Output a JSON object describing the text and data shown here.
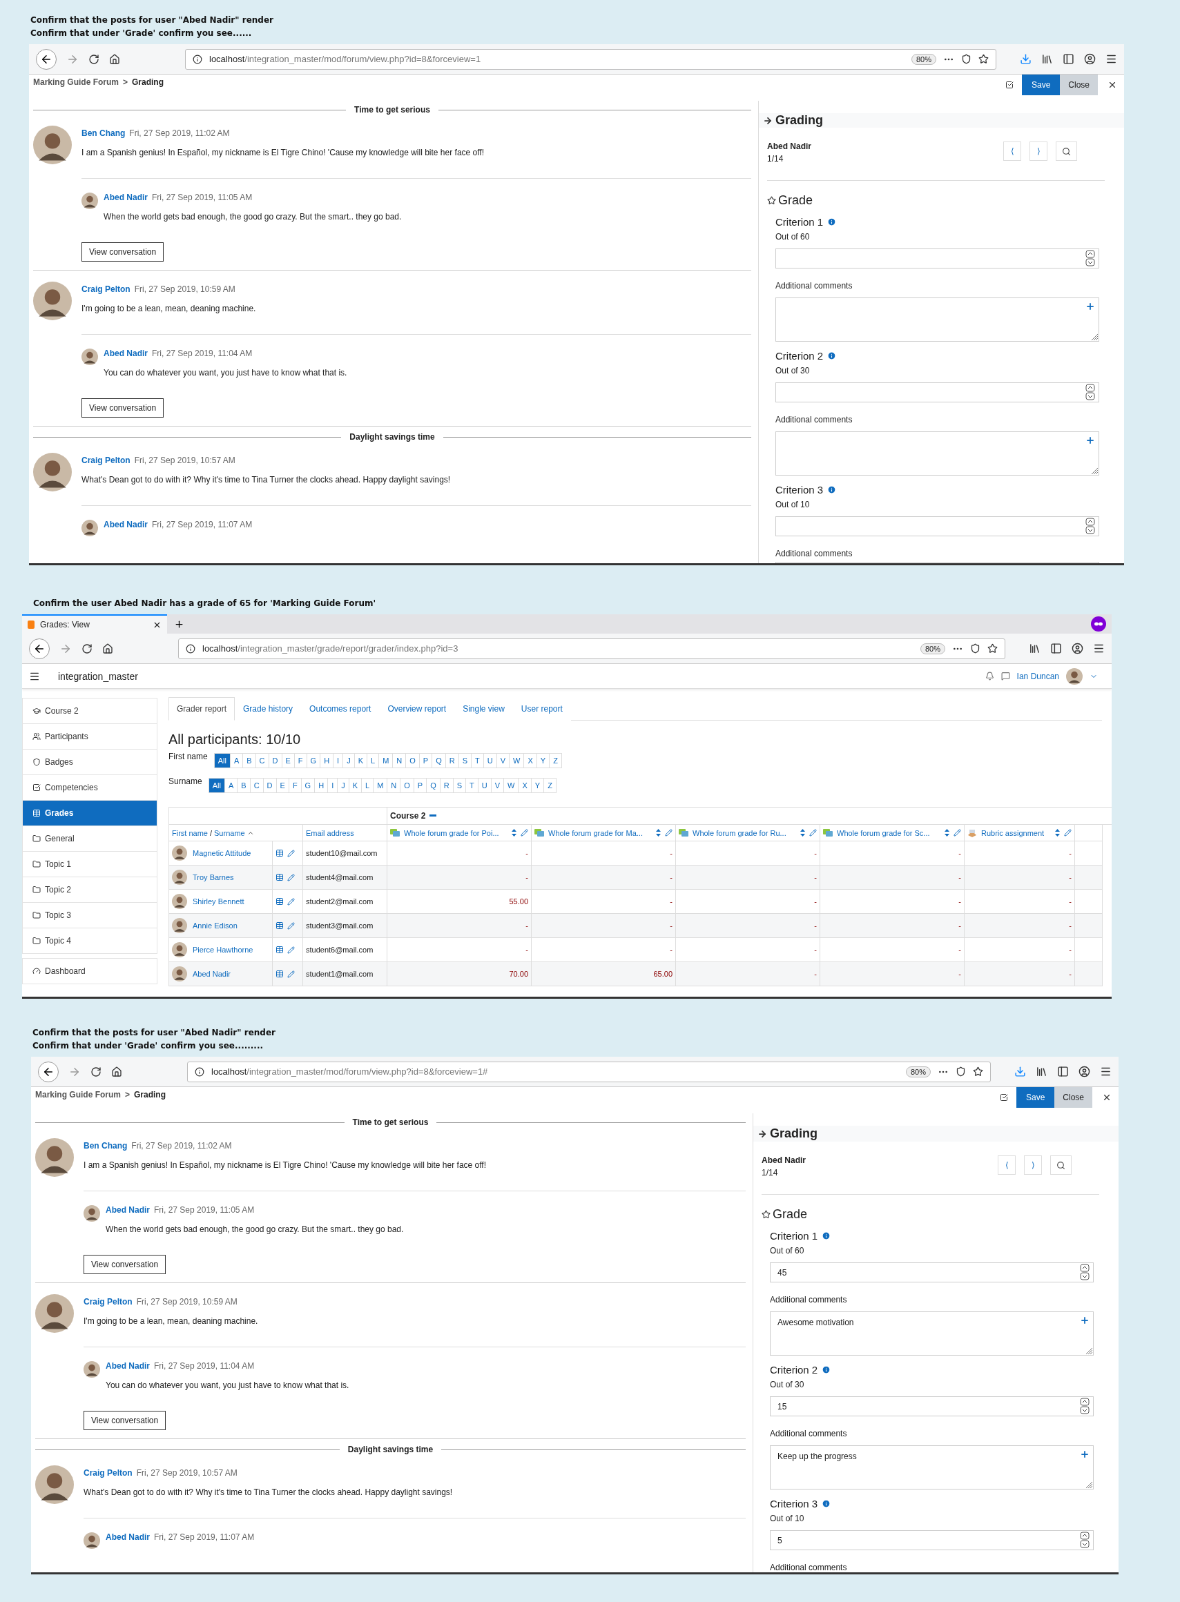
{
  "sections": [
    {
      "kind": "forum",
      "captions": [
        "Confirm that the posts for user \"Abed Nadir\" render",
        "Confirm that under 'Grade' confirm you see......"
      ],
      "browser": {
        "url_host": "localhost",
        "url_path": "/integration_master/mod/forum/view.php?id=8&forceview=1",
        "zoom": "80%"
      },
      "breadcrumb": {
        "items": [
          "Marking Guide Forum",
          "Grading"
        ],
        "separator": ">"
      },
      "actions": {
        "save": "Save",
        "close": "Close"
      },
      "discussions": [
        {
          "title": "Time to get serious",
          "posts": [
            {
              "author": "Ben Chang",
              "date": "Fri, 27 Sep 2019, 11:02 AM",
              "text": "I am a Spanish genius! In Español, my nickname is El Tigre Chino! 'Cause my knowledge will bite her face off!",
              "replies": [
                {
                  "author": "Abed Nadir",
                  "date": "Fri, 27 Sep 2019, 11:05 AM",
                  "text": "When the world gets bad enough, the good go crazy. But the smart.. they go bad."
                }
              ],
              "button": "View conversation"
            },
            {
              "author": "Craig Pelton",
              "date": "Fri, 27 Sep 2019, 10:59 AM",
              "text": "I'm going to be a lean, mean, deaning machine.",
              "replies": [
                {
                  "author": "Abed Nadir",
                  "date": "Fri, 27 Sep 2019, 11:04 AM",
                  "text": "You can do whatever you want, you just have to know what that is."
                }
              ],
              "button": "View conversation"
            }
          ]
        },
        {
          "title": "Daylight savings time",
          "posts": [
            {
              "author": "Craig Pelton",
              "date": "Fri, 27 Sep 2019, 10:57 AM",
              "text": "What's Dean got to do with it? Why it's time to Tina Turner the clocks ahead. Happy daylight savings!",
              "replies": [
                {
                  "author": "Abed Nadir",
                  "date": "Fri, 27 Sep 2019, 11:07 AM"
                }
              ]
            }
          ]
        }
      ],
      "grading": {
        "title": "Grading",
        "student": "Abed Nadir",
        "position": "1/14",
        "prev": "⟨",
        "next": "⟩",
        "section": "Grade",
        "criteria": [
          {
            "name": "Criterion 1",
            "out_of": "Out of 60",
            "comment_label": "Additional comments",
            "kind": "full"
          },
          {
            "name": "Criterion 2",
            "out_of": "Out of 30",
            "comment_label": "Additional comments",
            "kind": "full"
          },
          {
            "name": "Criterion 3",
            "out_of": "Out of 10",
            "comment_label": "Additional comments",
            "kind": "partial"
          }
        ]
      }
    },
    {
      "kind": "grades",
      "captions": [
        "Confirm the user Abed Nadir has a grade of 65 for 'Marking Guide Forum'"
      ],
      "browser": {
        "tab_title": "Grades: View",
        "url_host": "localhost",
        "url_path": "/integration_master/grade/report/grader/index.php?id=3",
        "zoom": "80%"
      },
      "site_name": "integration_master",
      "user_name": "Ian Duncan",
      "sidebar": [
        {
          "label": "Course 2",
          "selected": false
        },
        {
          "label": "Participants",
          "selected": false
        },
        {
          "label": "Badges",
          "selected": false
        },
        {
          "label": "Competencies",
          "selected": false
        },
        {
          "label": "Grades",
          "selected": true
        },
        {
          "label": "General",
          "selected": false
        },
        {
          "label": "Topic 1",
          "selected": false
        },
        {
          "label": "Topic 2",
          "selected": false
        },
        {
          "label": "Topic 3",
          "selected": false
        },
        {
          "label": "Topic 4",
          "selected": false
        },
        {
          "label": "Dashboard",
          "selected": false
        }
      ],
      "tabs": [
        {
          "label": "Grader report",
          "selected": true
        },
        {
          "label": "Grade history",
          "selected": false
        },
        {
          "label": "Outcomes report",
          "selected": false
        },
        {
          "label": "Overview report",
          "selected": false
        },
        {
          "label": "Single view",
          "selected": false
        },
        {
          "label": "User report",
          "selected": false
        }
      ],
      "heading": "All participants: 10/10",
      "filters": [
        {
          "label": "First name",
          "letters": [
            {
              "label": "All",
              "selected": true
            },
            {
              "label": "A",
              "selected": false
            },
            {
              "label": "B",
              "selected": false
            },
            {
              "label": "C",
              "selected": false
            },
            {
              "label": "D",
              "selected": false
            },
            {
              "label": "E",
              "selected": false
            },
            {
              "label": "F",
              "selected": false
            },
            {
              "label": "G",
              "selected": false
            },
            {
              "label": "H",
              "selected": false
            },
            {
              "label": "I",
              "selected": false
            },
            {
              "label": "J",
              "selected": false
            },
            {
              "label": "K",
              "selected": false
            },
            {
              "label": "L",
              "selected": false
            },
            {
              "label": "M",
              "selected": false
            },
            {
              "label": "N",
              "selected": false
            },
            {
              "label": "O",
              "selected": false
            },
            {
              "label": "P",
              "selected": false
            },
            {
              "label": "Q",
              "selected": false
            },
            {
              "label": "R",
              "selected": false
            },
            {
              "label": "S",
              "selected": false
            },
            {
              "label": "T",
              "selected": false
            },
            {
              "label": "U",
              "selected": false
            },
            {
              "label": "V",
              "selected": false
            },
            {
              "label": "W",
              "selected": false
            },
            {
              "label": "X",
              "selected": false
            },
            {
              "label": "Y",
              "selected": false
            },
            {
              "label": "Z",
              "selected": false
            }
          ]
        },
        {
          "label": "Surname",
          "letters": [
            {
              "label": "All",
              "selected": true
            },
            {
              "label": "A",
              "selected": false
            },
            {
              "label": "B",
              "selected": false
            },
            {
              "label": "C",
              "selected": false
            },
            {
              "label": "D",
              "selected": false
            },
            {
              "label": "E",
              "selected": false
            },
            {
              "label": "F",
              "selected": false
            },
            {
              "label": "G",
              "selected": false
            },
            {
              "label": "H",
              "selected": false
            },
            {
              "label": "I",
              "selected": false
            },
            {
              "label": "J",
              "selected": false
            },
            {
              "label": "K",
              "selected": false
            },
            {
              "label": "L",
              "selected": false
            },
            {
              "label": "M",
              "selected": false
            },
            {
              "label": "N",
              "selected": false
            },
            {
              "label": "O",
              "selected": false
            },
            {
              "label": "P",
              "selected": false
            },
            {
              "label": "Q",
              "selected": false
            },
            {
              "label": "R",
              "selected": false
            },
            {
              "label": "S",
              "selected": false
            },
            {
              "label": "T",
              "selected": false
            },
            {
              "label": "U",
              "selected": false
            },
            {
              "label": "V",
              "selected": false
            },
            {
              "label": "W",
              "selected": false
            },
            {
              "label": "X",
              "selected": false
            },
            {
              "label": "Y",
              "selected": false
            },
            {
              "label": "Z",
              "selected": false
            }
          ]
        }
      ],
      "table": {
        "course": "Course 2",
        "name_columns": [
          "First name",
          "/",
          "Surname"
        ],
        "email_column": "Email address",
        "grade_columns": [
          {
            "label": "Whole forum grade for Poi...",
            "kind": "forum"
          },
          {
            "label": "Whole forum grade for Ma...",
            "kind": "forum"
          },
          {
            "label": "Whole forum grade for Ru...",
            "kind": "forum"
          },
          {
            "label": "Whole forum grade for Sc...",
            "kind": "forum"
          },
          {
            "label": "Rubric assignment",
            "kind": "assignment"
          }
        ],
        "rows": [
          {
            "name": "Magnetic Attitude",
            "email": "student10@mail.com",
            "grades": [
              "-",
              "-",
              "-",
              "-",
              "-"
            ]
          },
          {
            "name": "Troy Barnes",
            "email": "student4@mail.com",
            "grades": [
              "-",
              "-",
              "-",
              "-",
              "-"
            ]
          },
          {
            "name": "Shirley Bennett",
            "email": "student2@mail.com",
            "grades": [
              "55.00",
              "-",
              "-",
              "-",
              "-"
            ]
          },
          {
            "name": "Annie Edison",
            "email": "student3@mail.com",
            "grades": [
              "-",
              "-",
              "-",
              "-",
              "-"
            ]
          },
          {
            "name": "Pierce Hawthorne",
            "email": "student6@mail.com",
            "grades": [
              "-",
              "-",
              "-",
              "-",
              "-"
            ]
          },
          {
            "name": "Abed Nadir",
            "email": "student1@mail.com",
            "grades": [
              "70.00",
              "65.00",
              "-",
              "-",
              "-"
            ]
          }
        ]
      }
    },
    {
      "kind": "forum",
      "captions": [
        "Confirm that the posts for user \"Abed Nadir\" render",
        "Confirm that under 'Grade' confirm you see........."
      ],
      "browser": {
        "url_host": "localhost",
        "url_path": "/integration_master/mod/forum/view.php?id=8&forceview=1#",
        "zoom": "80%"
      },
      "breadcrumb": {
        "items": [
          "Marking Guide Forum",
          "Grading"
        ],
        "separator": ">"
      },
      "actions": {
        "save": "Save",
        "close": "Close"
      },
      "discussions": [
        {
          "title": "Time to get serious",
          "posts": [
            {
              "author": "Ben Chang",
              "date": "Fri, 27 Sep 2019, 11:02 AM",
              "text": "I am a Spanish genius! In Español, my nickname is El Tigre Chino! 'Cause my knowledge will bite her face off!",
              "replies": [
                {
                  "author": "Abed Nadir",
                  "date": "Fri, 27 Sep 2019, 11:05 AM",
                  "text": "When the world gets bad enough, the good go crazy. But the smart.. they go bad."
                }
              ],
              "button": "View conversation"
            },
            {
              "author": "Craig Pelton",
              "date": "Fri, 27 Sep 2019, 10:59 AM",
              "text": "I'm going to be a lean, mean, deaning machine.",
              "replies": [
                {
                  "author": "Abed Nadir",
                  "date": "Fri, 27 Sep 2019, 11:04 AM",
                  "text": "You can do whatever you want, you just have to know what that is."
                }
              ],
              "button": "View conversation"
            }
          ]
        },
        {
          "title": "Daylight savings time",
          "posts": [
            {
              "author": "Craig Pelton",
              "date": "Fri, 27 Sep 2019, 10:57 AM",
              "text": "What's Dean got to do with it? Why it's time to Tina Turner the clocks ahead. Happy daylight savings!",
              "replies": [
                {
                  "author": "Abed Nadir",
                  "date": "Fri, 27 Sep 2019, 11:07 AM"
                }
              ]
            }
          ]
        }
      ],
      "grading": {
        "title": "Grading",
        "student": "Abed Nadir",
        "position": "1/14",
        "prev": "⟨",
        "next": "⟩",
        "section": "Grade",
        "criteria": [
          {
            "name": "Criterion 1",
            "out_of": "Out of 60",
            "value": "45",
            "comment_label": "Additional comments",
            "kind": "full",
            "comment": "Awesome motivation"
          },
          {
            "name": "Criterion 2",
            "out_of": "Out of 30",
            "value": "15",
            "comment_label": "Additional comments",
            "kind": "full",
            "comment": "Keep up the progress"
          },
          {
            "name": "Criterion 3",
            "out_of": "Out of 10",
            "value": "5",
            "comment_label": "Additional comments",
            "kind": "cut"
          }
        ]
      }
    }
  ]
}
